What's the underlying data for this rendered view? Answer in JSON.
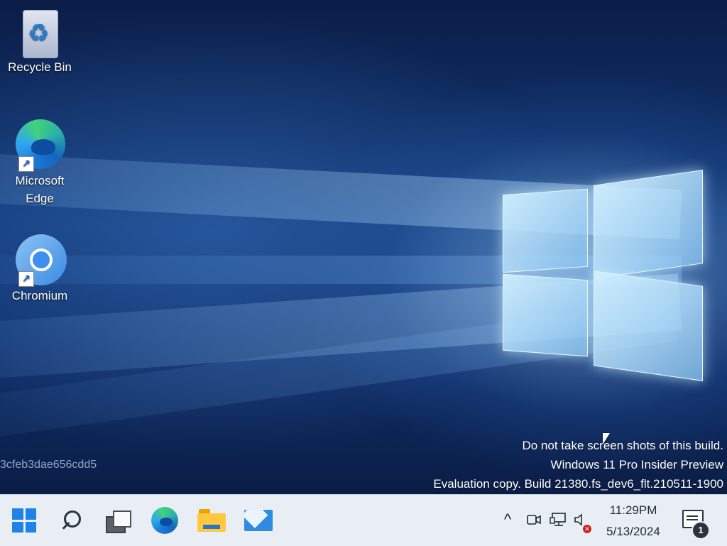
{
  "desktop": {
    "icons": [
      {
        "label": "Recycle Bin",
        "icon": "recycle-bin-icon"
      },
      {
        "label": "Microsoft Edge",
        "icon": "edge-icon",
        "shortcut": true
      },
      {
        "label": "Chromium",
        "icon": "chromium-icon",
        "shortcut": true
      }
    ],
    "build_hash": "3cfeb3dae656cdd5",
    "watermark": {
      "line1": "Do not take screen shots of this build.",
      "line2": "Windows 11 Pro Insider Preview",
      "line3": "Evaluation copy. Build 21380.fs_dev6_flt.210511-1900"
    }
  },
  "taskbar": {
    "buttons": [
      {
        "name": "start",
        "icon": "windows-start-icon"
      },
      {
        "name": "search",
        "icon": "search-icon"
      },
      {
        "name": "task-view",
        "icon": "task-view-icon"
      },
      {
        "name": "edge",
        "icon": "edge-icon"
      },
      {
        "name": "file-explorer",
        "icon": "folder-icon"
      },
      {
        "name": "mail",
        "icon": "mail-icon"
      }
    ],
    "tray": {
      "chevron": "^",
      "icons": [
        "meet-now-icon",
        "network-icon",
        "volume-muted-icon"
      ],
      "time": "11:29PM",
      "date": "5/13/2024",
      "notification_count": "1"
    }
  },
  "colors": {
    "taskbar_bg": "#e9eef5",
    "start_blue": "#1e82e6",
    "wallpaper_dark": "#0b1d47"
  }
}
